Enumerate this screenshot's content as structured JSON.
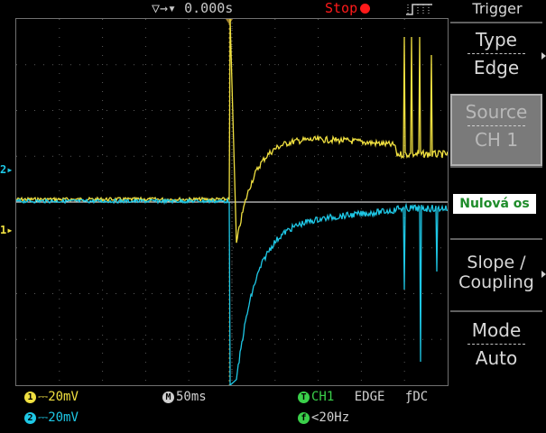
{
  "top": {
    "time_offset": "0.000s",
    "run_state": "Stop",
    "trigger_icon": "trigger-edge-rising-icon"
  },
  "menu": {
    "title": "Trigger",
    "type_label": "Type",
    "type_value": "Edge",
    "source_label": "Source",
    "source_value": "CH 1",
    "slope_label_1": "Slope /",
    "slope_label_2": "Coupling",
    "mode_label": "Mode",
    "mode_value": "Auto"
  },
  "annotation": {
    "text": "Nulová os"
  },
  "markers": {
    "ch2": "2",
    "ch1": "1"
  },
  "status": {
    "ch1_badge": "1",
    "ch1_scale": "20mV",
    "ch2_badge": "2",
    "ch2_scale": "20mV",
    "timebase_badge": "M",
    "timebase": "50ms",
    "trig_badge": "T",
    "trig_source": "CH1",
    "trig_type": "EDGE",
    "trig_coupling": "DC",
    "freq_badge": "f",
    "frequency": "<20Hz"
  },
  "colors": {
    "ch1": "#f0e040",
    "ch2": "#1ec8e6",
    "trigger": "#3ad04a",
    "run_state": "#ff1a1a",
    "annotation_text": "#1e8c2a"
  }
}
